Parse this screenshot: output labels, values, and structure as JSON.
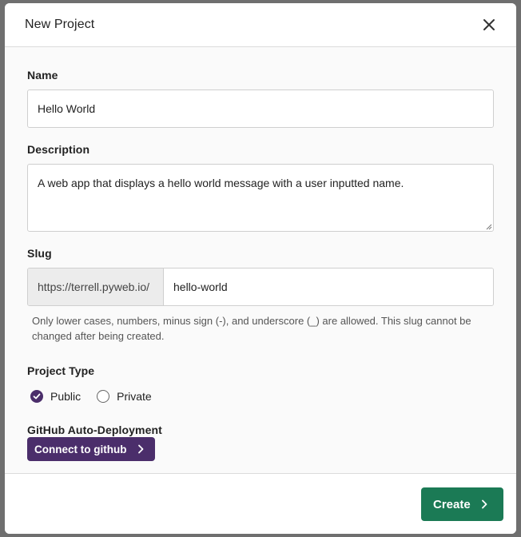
{
  "modal": {
    "title": "New Project"
  },
  "form": {
    "name": {
      "label": "Name",
      "value": "Hello World"
    },
    "description": {
      "label": "Description",
      "value": "A web app that displays a hello world message with a user inputted name."
    },
    "slug": {
      "label": "Slug",
      "prefix": "https://terrell.pyweb.io/",
      "value": "hello-world",
      "help": "Only lower cases, numbers, minus sign (-), and underscore (_) are allowed. This slug cannot be changed after being created."
    },
    "project_type": {
      "label": "Project Type",
      "options": [
        {
          "label": "Public",
          "checked": true
        },
        {
          "label": "Private",
          "checked": false
        }
      ]
    },
    "github": {
      "label": "GitHub Auto-Deployment",
      "button_label": "Connect to github"
    }
  },
  "footer": {
    "create_label": "Create"
  },
  "colors": {
    "purple": "#4b2e6b",
    "green": "#1b7a55"
  },
  "icons": {
    "close": "close-icon",
    "chevron": "chevron-right-icon",
    "check": "check-icon"
  }
}
